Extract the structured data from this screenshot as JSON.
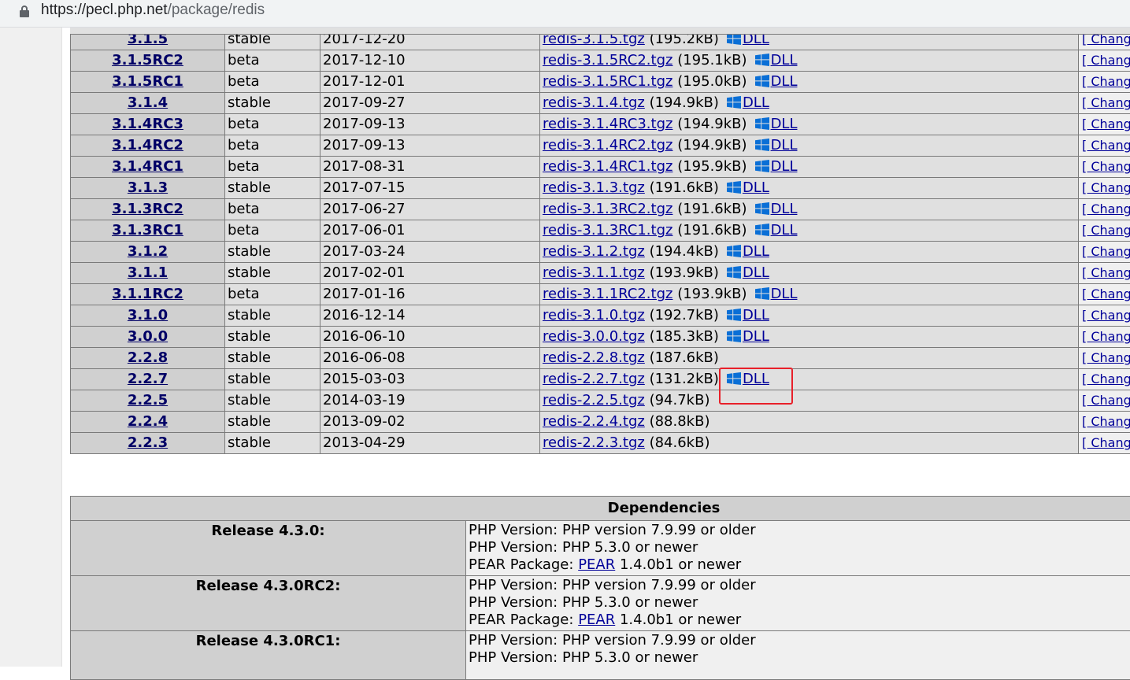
{
  "browser": {
    "url_host": "https://pecl.php.net",
    "url_path": "/package/redis"
  },
  "releases": [
    {
      "version": "3.1.5",
      "state": "stable",
      "date": "2017-12-20",
      "file": "redis-3.1.5.tgz",
      "size": "(195.2kB)",
      "dll": "DLL",
      "changelog": "[ Chang"
    },
    {
      "version": "3.1.5RC2",
      "state": "beta",
      "date": "2017-12-10",
      "file": "redis-3.1.5RC2.tgz",
      "size": "(195.1kB)",
      "dll": "DLL",
      "changelog": "[ Chang"
    },
    {
      "version": "3.1.5RC1",
      "state": "beta",
      "date": "2017-12-01",
      "file": "redis-3.1.5RC1.tgz",
      "size": "(195.0kB)",
      "dll": "DLL",
      "changelog": "[ Chang"
    },
    {
      "version": "3.1.4",
      "state": "stable",
      "date": "2017-09-27",
      "file": "redis-3.1.4.tgz",
      "size": "(194.9kB)",
      "dll": "DLL",
      "changelog": "[ Chang"
    },
    {
      "version": "3.1.4RC3",
      "state": "beta",
      "date": "2017-09-13",
      "file": "redis-3.1.4RC3.tgz",
      "size": "(194.9kB)",
      "dll": "DLL",
      "changelog": "[ Chang"
    },
    {
      "version": "3.1.4RC2",
      "state": "beta",
      "date": "2017-09-13",
      "file": "redis-3.1.4RC2.tgz",
      "size": "(194.9kB)",
      "dll": "DLL",
      "changelog": "[ Chang"
    },
    {
      "version": "3.1.4RC1",
      "state": "beta",
      "date": "2017-08-31",
      "file": "redis-3.1.4RC1.tgz",
      "size": "(195.9kB)",
      "dll": "DLL",
      "changelog": "[ Chang"
    },
    {
      "version": "3.1.3",
      "state": "stable",
      "date": "2017-07-15",
      "file": "redis-3.1.3.tgz",
      "size": "(191.6kB)",
      "dll": "DLL",
      "changelog": "[ Chang"
    },
    {
      "version": "3.1.3RC2",
      "state": "beta",
      "date": "2017-06-27",
      "file": "redis-3.1.3RC2.tgz",
      "size": "(191.6kB)",
      "dll": "DLL",
      "changelog": "[ Chang"
    },
    {
      "version": "3.1.3RC1",
      "state": "beta",
      "date": "2017-06-01",
      "file": "redis-3.1.3RC1.tgz",
      "size": "(191.6kB)",
      "dll": "DLL",
      "changelog": "[ Chang"
    },
    {
      "version": "3.1.2",
      "state": "stable",
      "date": "2017-03-24",
      "file": "redis-3.1.2.tgz",
      "size": "(194.4kB)",
      "dll": "DLL",
      "changelog": "[ Chang"
    },
    {
      "version": "3.1.1",
      "state": "stable",
      "date": "2017-02-01",
      "file": "redis-3.1.1.tgz",
      "size": "(193.9kB)",
      "dll": "DLL",
      "changelog": "[ Chang"
    },
    {
      "version": "3.1.1RC2",
      "state": "beta",
      "date": "2017-01-16",
      "file": "redis-3.1.1RC2.tgz",
      "size": "(193.9kB)",
      "dll": "DLL",
      "changelog": "[ Chang"
    },
    {
      "version": "3.1.0",
      "state": "stable",
      "date": "2016-12-14",
      "file": "redis-3.1.0.tgz",
      "size": "(192.7kB)",
      "dll": "DLL",
      "changelog": "[ Chang"
    },
    {
      "version": "3.0.0",
      "state": "stable",
      "date": "2016-06-10",
      "file": "redis-3.0.0.tgz",
      "size": "(185.3kB)",
      "dll": "DLL",
      "changelog": "[ Chang"
    },
    {
      "version": "2.2.8",
      "state": "stable",
      "date": "2016-06-08",
      "file": "redis-2.2.8.tgz",
      "size": "(187.6kB)",
      "dll": "",
      "changelog": "[ Chang"
    },
    {
      "version": "2.2.7",
      "state": "stable",
      "date": "2015-03-03",
      "file": "redis-2.2.7.tgz",
      "size": "(131.2kB)",
      "dll": "DLL",
      "changelog": "[ Chang"
    },
    {
      "version": "2.2.5",
      "state": "stable",
      "date": "2014-03-19",
      "file": "redis-2.2.5.tgz",
      "size": "(94.7kB)",
      "dll": "",
      "changelog": "[ Chang"
    },
    {
      "version": "2.2.4",
      "state": "stable",
      "date": "2013-09-02",
      "file": "redis-2.2.4.tgz",
      "size": "(88.8kB)",
      "dll": "",
      "changelog": "[ Chang"
    },
    {
      "version": "2.2.3",
      "state": "stable",
      "date": "2013-04-29",
      "file": "redis-2.2.3.tgz",
      "size": "(84.6kB)",
      "dll": "",
      "changelog": "[ Chang"
    }
  ],
  "dependencies": {
    "header": "Dependencies",
    "rows": [
      {
        "release": "Release 4.3.0:",
        "php_max_label": "PHP Version:",
        "php_max": "PHP version 7.9.99 or older",
        "php_min_label": "PHP Version:",
        "php_min": "PHP 5.3.0 or newer",
        "pear_label": "PEAR Package:",
        "pear_link": "PEAR",
        "pear_ver": "1.4.0b1 or newer"
      },
      {
        "release": "Release 4.3.0RC2:",
        "php_max_label": "PHP Version:",
        "php_max": "PHP version 7.9.99 or older",
        "php_min_label": "PHP Version:",
        "php_min": "PHP 5.3.0 or newer",
        "pear_label": "PEAR Package:",
        "pear_link": "PEAR",
        "pear_ver": "1.4.0b1 or newer"
      },
      {
        "release": "Release 4.3.0RC1:",
        "php_max_label": "PHP Version:",
        "php_max": "PHP version 7.9.99 or older",
        "php_min_label": "PHP Version:",
        "php_min": "PHP 5.3.0 or newer"
      }
    ]
  },
  "colors": {
    "link": "#000099",
    "highlight_box": "#e8202a",
    "windows_icon": "#0a6fd6"
  }
}
